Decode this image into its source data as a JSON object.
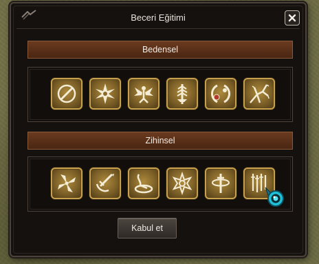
{
  "window": {
    "title": "Beceri Eğitimi",
    "close_glyph": "✕"
  },
  "sections": [
    {
      "header": "Bedensel",
      "skills": [
        {
          "icon": "slash-circle-icon"
        },
        {
          "icon": "starburst-icon"
        },
        {
          "icon": "winged-figure-icon"
        },
        {
          "icon": "feathered-blade-icon"
        },
        {
          "icon": "crescent-orbs-icon"
        },
        {
          "icon": "thorny-branches-icon"
        }
      ]
    },
    {
      "header": "Zihinsel",
      "skills": [
        {
          "icon": "pinwheel-icon"
        },
        {
          "icon": "anchor-sword-icon"
        },
        {
          "icon": "whirlwind-icon"
        },
        {
          "icon": "lotus-mandala-icon"
        },
        {
          "icon": "spinning-sword-icon"
        },
        {
          "icon": "falling-blades-icon"
        }
      ]
    }
  ],
  "accept_button": "Kabul et",
  "cursor_icon": "eye-cursor-icon",
  "colors": {
    "header_bar": "#5b2f18",
    "slot_border": "#c7a14d",
    "slot_fill": "#8a6a2c",
    "glyph_cream": "#f4ecd4",
    "cursor_cyan": "#1ec0d6"
  }
}
